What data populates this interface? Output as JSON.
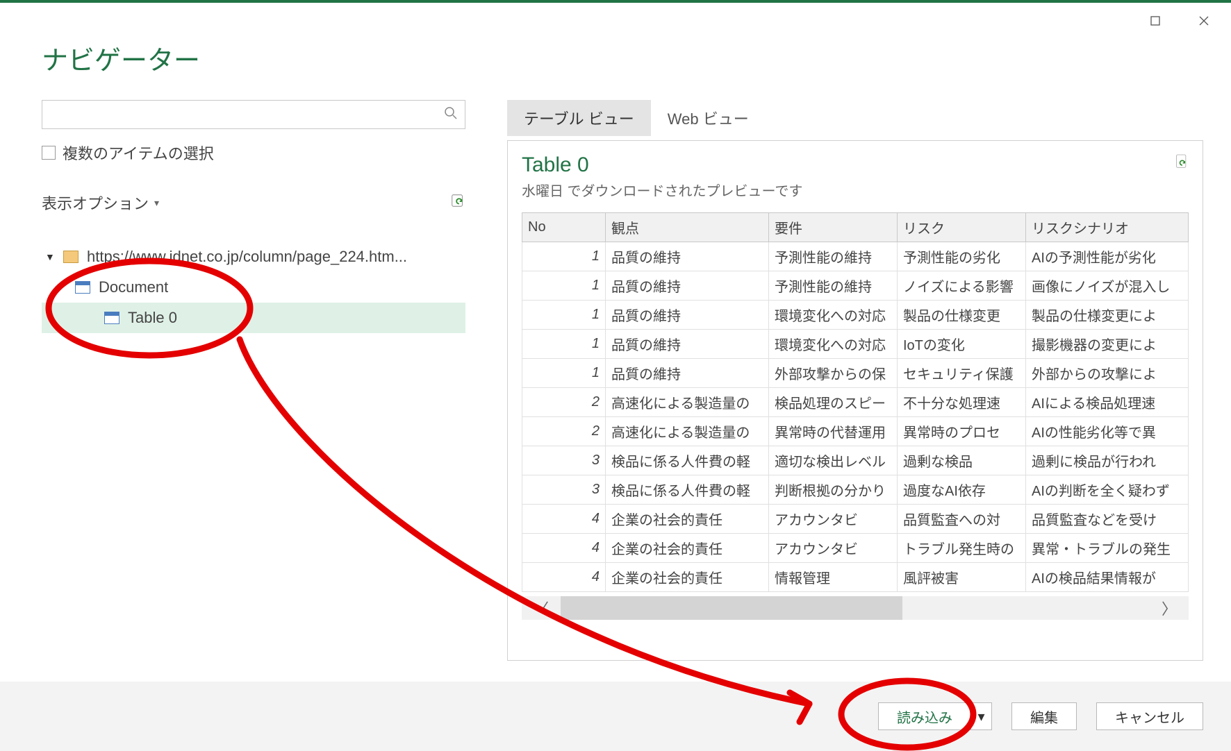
{
  "title": "ナビゲーター",
  "window": {
    "maximize": "maximize",
    "close": "close"
  },
  "left": {
    "search_placeholder": "",
    "multiselect_label": "複数のアイテムの選択",
    "display_options_label": "表示オプション",
    "tree": {
      "root": "https://www.idnet.co.jp/column/page_224.htm...",
      "doc": "Document",
      "table": "Table 0"
    }
  },
  "tabs": {
    "table_view": "テーブル ビュー",
    "web_view": "Web ビュー"
  },
  "preview": {
    "name": "Table 0",
    "subtitle": "水曜日 でダウンロードされたプレビューです",
    "columns": {
      "no": "No",
      "c1": "観点",
      "c2": "要件",
      "c3": "リスク",
      "c4": "リスクシナリオ"
    },
    "rows": [
      {
        "no": "1",
        "c1": "品質の維持",
        "c2": "予測性能の維持",
        "c3": "予測性能の劣化",
        "c4": "AIの予測性能が劣化"
      },
      {
        "no": "1",
        "c1": "品質の維持",
        "c2": "予測性能の維持",
        "c3": "ノイズによる影響",
        "c4": "画像にノイズが混入し"
      },
      {
        "no": "1",
        "c1": "品質の維持",
        "c2": "環境変化への対応",
        "c3": "製品の仕様変更",
        "c4": "製品の仕様変更によ"
      },
      {
        "no": "1",
        "c1": "品質の維持",
        "c2": "環境変化への対応",
        "c3": "IoTの変化",
        "c4": "撮影機器の変更によ"
      },
      {
        "no": "1",
        "c1": "品質の維持",
        "c2": "外部攻撃からの保",
        "c3": "セキュリティ保護",
        "c4": "外部からの攻撃によ"
      },
      {
        "no": "2",
        "c1": "高速化による製造量の",
        "c2": "検品処理のスピー",
        "c3": "不十分な処理速",
        "c4": "AIによる検品処理速"
      },
      {
        "no": "2",
        "c1": "高速化による製造量の",
        "c2": "異常時の代替運用",
        "c3": "異常時のプロセ",
        "c4": "AIの性能劣化等で異"
      },
      {
        "no": "3",
        "c1": "検品に係る人件費の軽",
        "c2": "適切な検出レベル",
        "c3": "過剰な検品",
        "c4": "過剰に検品が行われ"
      },
      {
        "no": "3",
        "c1": "検品に係る人件費の軽",
        "c2": "判断根拠の分かり",
        "c3": "過度なAI依存",
        "c4": "AIの判断を全く疑わず"
      },
      {
        "no": "4",
        "c1": "企業の社会的責任",
        "c2": "アカウンタビ",
        "c3": "品質監査への対",
        "c4": "品質監査などを受け"
      },
      {
        "no": "4",
        "c1": "企業の社会的責任",
        "c2": "アカウンタビ",
        "c3": "トラブル発生時の",
        "c4": "異常・トラブルの発生"
      },
      {
        "no": "4",
        "c1": "企業の社会的責任",
        "c2": "情報管理",
        "c3": "風評被害",
        "c4": "AIの検品結果情報が"
      }
    ]
  },
  "footer": {
    "load": "読み込み",
    "edit": "編集",
    "cancel": "キャンセル"
  }
}
